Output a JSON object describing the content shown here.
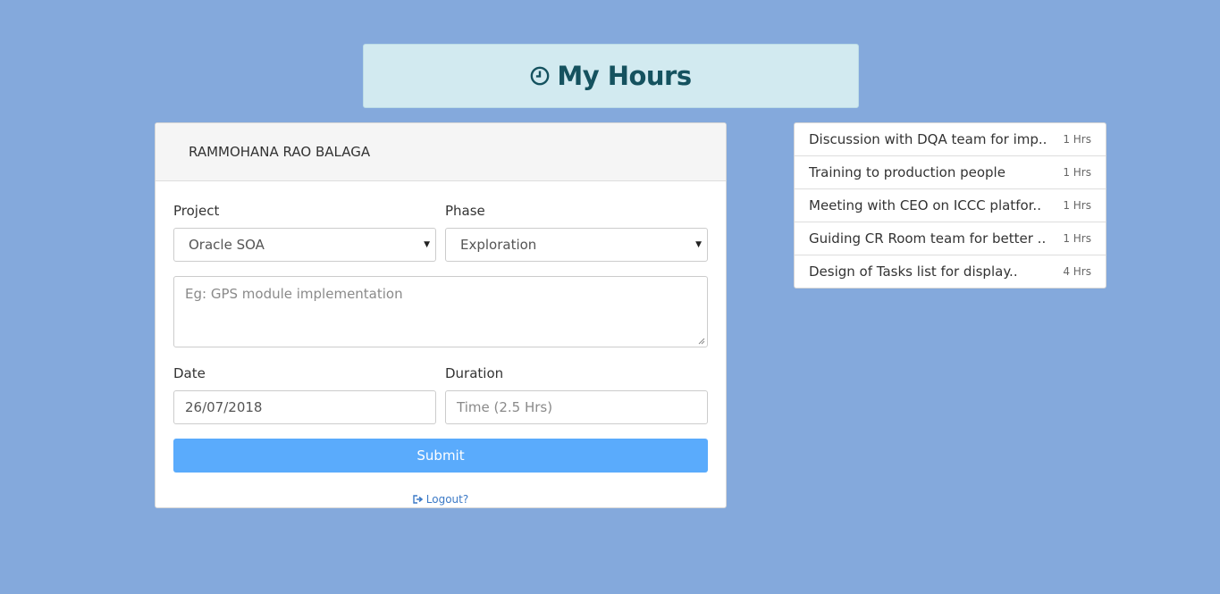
{
  "header": {
    "title": "My Hours",
    "icon": "clock-icon"
  },
  "form": {
    "user_name": "RAMMOHANA RAO BALAGA",
    "project_label": "Project",
    "project_value": "Oracle SOA",
    "phase_label": "Phase",
    "phase_value": "Exploration",
    "description_placeholder": "Eg: GPS module implementation",
    "date_label": "Date",
    "date_value": "26/07/2018",
    "duration_label": "Duration",
    "duration_placeholder": "Time (2.5 Hrs)",
    "submit_label": "Submit",
    "logout_label": "Logout?"
  },
  "tasks": [
    {
      "title": "Discussion with DQA team for imp..",
      "hours": "1 Hrs"
    },
    {
      "title": "Training to production people",
      "hours": "1 Hrs"
    },
    {
      "title": "Meeting with CEO on ICCC platfor..",
      "hours": "1 Hrs"
    },
    {
      "title": "Guiding CR Room team for better ..",
      "hours": "1 Hrs"
    },
    {
      "title": "Design of Tasks list for display..",
      "hours": "4 Hrs"
    }
  ],
  "colors": {
    "background": "#84a9dc",
    "banner": "#d2eaf0",
    "title_text": "#15525f",
    "submit": "#5aabfc",
    "link": "#3b79c6"
  }
}
